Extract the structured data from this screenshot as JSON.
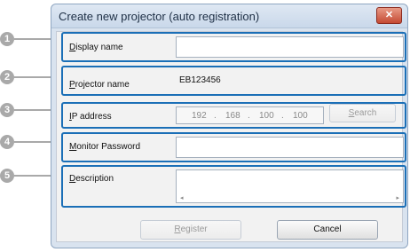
{
  "dialog": {
    "title": "Create new projector (auto registration)",
    "close_label": "✕"
  },
  "callouts": [
    "1",
    "2",
    "3",
    "4",
    "5"
  ],
  "fields": {
    "display_name": {
      "label_accel": "D",
      "label_rest": "isplay name",
      "value": ""
    },
    "projector_name": {
      "label_accel": "P",
      "label_rest": "rojector name",
      "value": "EB123456"
    },
    "ip_address": {
      "label_accel": "I",
      "label_rest": "P address",
      "octets": [
        "192",
        "168",
        "100",
        "100"
      ],
      "dot": "."
    },
    "monitor_password": {
      "label_accel": "M",
      "label_rest": "onitor Password",
      "value": ""
    },
    "description": {
      "label_accel": "D",
      "label_rest": "escription",
      "value": ""
    }
  },
  "buttons": {
    "search_accel": "S",
    "search_rest": "earch",
    "register_accel": "R",
    "register_rest": "egister",
    "cancel": "Cancel"
  },
  "scroll": {
    "left": "◂",
    "right": "▸"
  }
}
